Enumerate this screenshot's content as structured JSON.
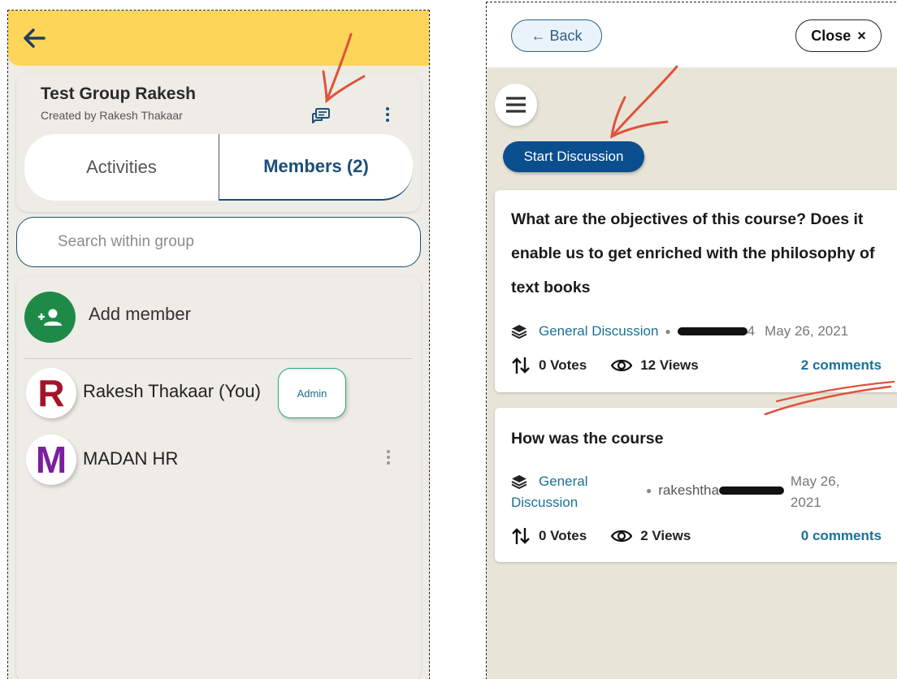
{
  "left": {
    "group_title": "Test Group Rakesh",
    "group_subtitle": "Created by Rakesh Thakaar",
    "tabs": [
      {
        "label": "Activities",
        "active": false
      },
      {
        "label": "Members (2)",
        "active": true
      }
    ],
    "search": {
      "placeholder": "Search within group"
    },
    "add_member_label": "Add member",
    "members": [
      {
        "initial": "R",
        "name": "Rakesh Thakaar (You)",
        "badge": "Admin",
        "initial_color": "#a3142a"
      },
      {
        "initial": "M",
        "name": "MADAN HR",
        "initial_color": "#7a1f9e"
      }
    ],
    "colors": {
      "topbar": "#fdd659",
      "accent": "#1a4e7a",
      "add_button": "#1f8a48"
    }
  },
  "right": {
    "back_label": "← Back",
    "close_label": "Close",
    "close_icon": "×",
    "start_discussion_label": "Start Discussion",
    "discussions": [
      {
        "title_lines": [
          "What are the objectives of this course? Does it",
          "enable us to get enriched with the philosophy of",
          "text books"
        ],
        "category": "General Discussion",
        "author": "4",
        "date": "May 26, 2021",
        "votes": "0 Votes",
        "views": "12 Views",
        "comments": "2 comments"
      },
      {
        "title_lines": [
          "How was the course"
        ],
        "category_lines": [
          "General",
          "Discussion"
        ],
        "author": "rakeshtha",
        "date_lines": [
          "May 26,",
          "2021"
        ],
        "votes": "0 Votes",
        "views": "2 Views",
        "comments": "0 comments"
      }
    ],
    "colors": {
      "primary": "#0b4e8e",
      "link": "#1a7196",
      "background": "#e8e5d8"
    }
  }
}
